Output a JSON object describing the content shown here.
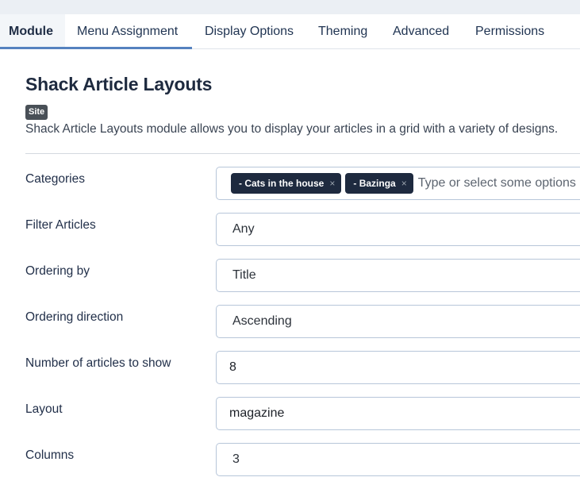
{
  "tabs": [
    {
      "label": "Module",
      "active": true
    },
    {
      "label": "Menu Assignment",
      "active": false
    },
    {
      "label": "Display Options",
      "active": false
    },
    {
      "label": "Theming",
      "active": false
    },
    {
      "label": "Advanced",
      "active": false
    },
    {
      "label": "Permissions",
      "active": false
    }
  ],
  "module": {
    "title": "Shack Article Layouts",
    "badge": "Site",
    "description": "Shack Article Layouts module allows you to display your articles in a grid with a variety of designs."
  },
  "fields": {
    "categories": {
      "label": "Categories",
      "chips": [
        "- Cats in the house",
        "- Bazinga"
      ],
      "remove_glyph": "×",
      "placeholder": "Type or select some options"
    },
    "filter_articles": {
      "label": "Filter Articles",
      "value": "Any"
    },
    "ordering_by": {
      "label": "Ordering by",
      "value": "Title"
    },
    "ordering_direction": {
      "label": "Ordering direction",
      "value": "Ascending"
    },
    "number_of_articles": {
      "label": "Number of articles to show",
      "value": "8"
    },
    "layout": {
      "label": "Layout",
      "value": "magazine"
    },
    "columns": {
      "label": "Columns",
      "value": "3"
    }
  },
  "colors": {
    "accent": "#5582bf",
    "chip_bg": "#1e2a3f",
    "badge_bg": "#495057",
    "input_border": "#b7c6d9"
  }
}
